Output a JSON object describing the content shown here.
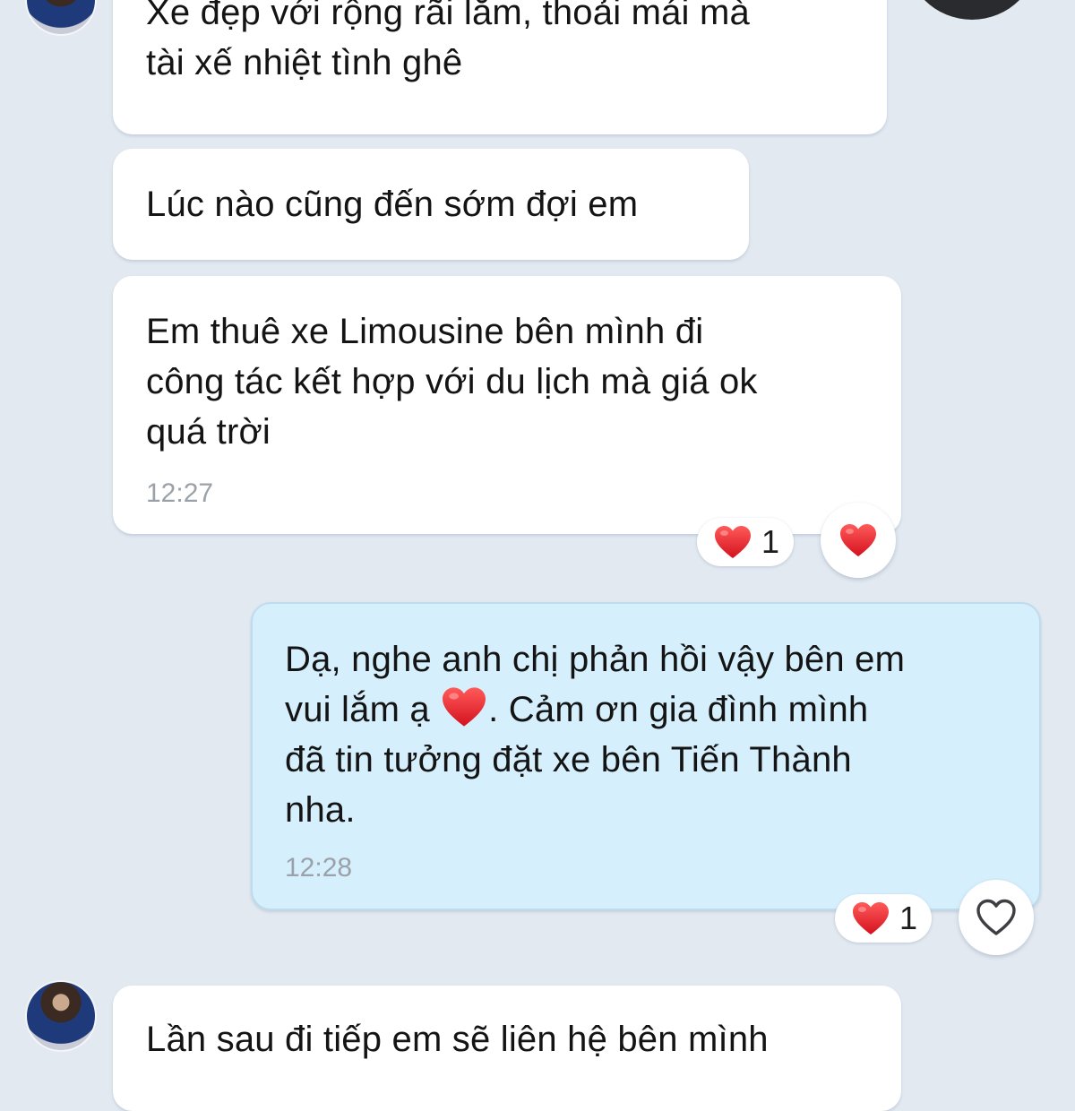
{
  "messages": [
    {
      "direction": "in",
      "text": "Xe đẹp với rộng rãi lắm, thoải mái mà\ntài xế nhiệt tình ghê"
    },
    {
      "direction": "in",
      "text": "Lúc nào cũng đến sớm đợi em"
    },
    {
      "direction": "in",
      "text": "Em thuê xe Limousine bên mình đi\ncông tác kết hợp với du lịch mà giá ok\nquá trời",
      "time": "12:27",
      "reaction": {
        "icon": "heart-icon",
        "count": "1"
      },
      "reaction_button_icon": "heart-filled-icon"
    },
    {
      "direction": "out",
      "text_before_emoji": "Dạ, nghe anh chị phản hồi vậy bên em\nvui lắm ạ ",
      "emoji": "heart-emoji-icon",
      "text_after_emoji": ". Cảm ơn gia đình mình\nđã tin tưởng đặt xe bên Tiến Thành\nnha.",
      "time": "12:28",
      "reaction": {
        "icon": "heart-icon",
        "count": "1"
      },
      "reaction_button_icon": "heart-outline-icon"
    },
    {
      "direction": "in",
      "text": "Lần sau đi tiếp em sẽ liên hệ bên mình"
    }
  ],
  "colors": {
    "background": "#e2e9f1",
    "incoming_bubble": "#ffffff",
    "outgoing_bubble": "#d5effc",
    "heart": "#e8202a",
    "timestamp": "#9ba1a8"
  }
}
